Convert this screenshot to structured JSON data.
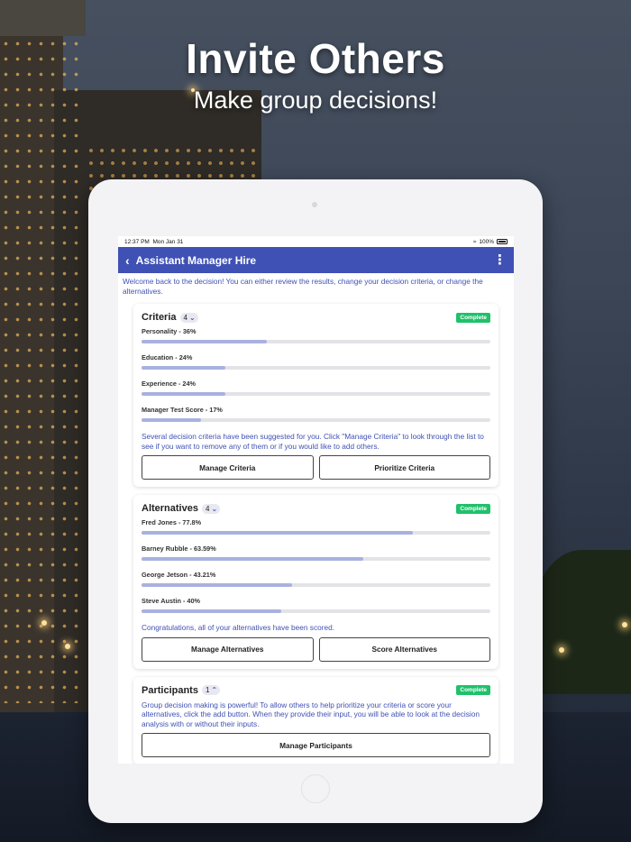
{
  "promo": {
    "title": "Invite Others",
    "subtitle": "Make group decisions!"
  },
  "status_bar": {
    "time": "12:37 PM",
    "date": "Mon Jan 31",
    "battery": "100%"
  },
  "app_bar": {
    "title": "Assistant Manager Hire",
    "back_icon": "chevron-left-icon",
    "menu_icon": "more-vertical-icon"
  },
  "welcome_text": "Welcome back to the decision! You can either review the results, change your decision criteria, or change the alternatives.",
  "criteria": {
    "title": "Criteria",
    "count": "4",
    "status": "Complete",
    "items": [
      {
        "label": "Personality - 36%",
        "value": 0.36
      },
      {
        "label": "Education - 24%",
        "value": 0.24
      },
      {
        "label": "Experience - 24%",
        "value": 0.24
      },
      {
        "label": "Manager Test Score - 17%",
        "value": 0.17
      }
    ],
    "note": "Several decision criteria have been suggested for you. Click \"Manage Criteria\" to look through the list to see if you want to remove any of them or if you would like to add others.",
    "buttons": [
      "Manage Criteria",
      "Prioritize Criteria"
    ]
  },
  "alternatives": {
    "title": "Alternatives",
    "count": "4",
    "status": "Complete",
    "items": [
      {
        "label": "Fred Jones - 77.8%",
        "value": 0.778
      },
      {
        "label": "Barney Rubble - 63.59%",
        "value": 0.6359
      },
      {
        "label": "George Jetson - 43.21%",
        "value": 0.4321
      },
      {
        "label": "Steve Austin - 40%",
        "value": 0.4
      }
    ],
    "note": "Congratulations, all of your alternatives have been scored.",
    "buttons": [
      "Manage Alternatives",
      "Score Alternatives"
    ]
  },
  "participants": {
    "title": "Participants",
    "count": "1",
    "status": "Complete",
    "note": "Group decision making is powerful! To allow others to help prioritize your criteria or score your alternatives, click the add button. When they provide their input, you will be able to look at the decision analysis with or without their inputs.",
    "button": "Manage Participants"
  },
  "colors": {
    "app_bar": "#3f51b5",
    "accent_text": "#3f51b5",
    "complete_badge": "#1fc16b",
    "bar_fill": "#a9b1df"
  }
}
